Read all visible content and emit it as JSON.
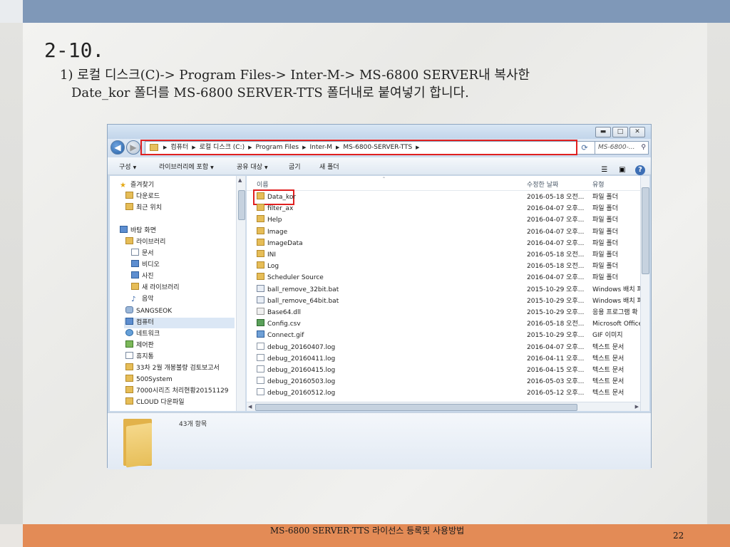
{
  "slide": {
    "title": "2-10.",
    "line1": "1) 로컬 디스크(C)-> Program Files-> Inter-M-> MS-6800 SERVER내 복사한",
    "line2": "Date_kor 폴더를 MS-6800 SERVER-TTS 폴더내로 붙여넣기 합니다.",
    "footer_text": "MS-6800 SERVER-TTS 라이선스 등록및 사용방법",
    "page_number": "22"
  },
  "explorer": {
    "address": [
      "컴퓨터",
      "로컬 디스크 (C:)",
      "Program Files",
      "Inter-M",
      "MS-6800-SERVER-TTS"
    ],
    "search_placeholder": "MS-6800-...",
    "toolbar": [
      "구성",
      "라이브러리에 포함",
      "공유 대상",
      "굽기",
      "새 폴더"
    ],
    "columns": {
      "name": "이름",
      "date": "수정한 날짜",
      "type": "유형"
    },
    "nav": [
      {
        "label": "즐겨찾기",
        "icon": "star-icon"
      },
      {
        "label": "다운로드",
        "icon": "folder-icon"
      },
      {
        "label": "최근 위치",
        "icon": "folder-icon"
      },
      {
        "label": "바탕 화면",
        "icon": "desktop-icon"
      },
      {
        "label": "라이브러리",
        "icon": "library-icon"
      },
      {
        "label": "문서",
        "icon": "document-icon"
      },
      {
        "label": "비디오",
        "icon": "video-icon"
      },
      {
        "label": "사진",
        "icon": "picture-icon"
      },
      {
        "label": "새 라이브러리",
        "icon": "library-icon"
      },
      {
        "label": "음악",
        "icon": "music-icon"
      },
      {
        "label": "SANGSEOK",
        "icon": "user-folder-icon"
      },
      {
        "label": "컴퓨터",
        "icon": "computer-icon"
      },
      {
        "label": "네트워크",
        "icon": "network-icon"
      },
      {
        "label": "제어판",
        "icon": "control-panel-icon"
      },
      {
        "label": "휴지통",
        "icon": "recycle-bin-icon"
      },
      {
        "label": "33차 2월 개봉불량 검토보고서",
        "icon": "folder-icon"
      },
      {
        "label": "500System",
        "icon": "folder-icon"
      },
      {
        "label": "7000시리즈 처리현황20151129",
        "icon": "folder-icon"
      },
      {
        "label": "CLOUD 다운파일",
        "icon": "folder-icon"
      }
    ],
    "files": [
      {
        "name": "Data_kor",
        "date": "2016-05-18 오전...",
        "type": "파일 폴더",
        "kind": "folder"
      },
      {
        "name": "filter_ax",
        "date": "2016-04-07 오후...",
        "type": "파일 폴더",
        "kind": "folder"
      },
      {
        "name": "Help",
        "date": "2016-04-07 오후...",
        "type": "파일 폴더",
        "kind": "folder"
      },
      {
        "name": "Image",
        "date": "2016-04-07 오후...",
        "type": "파일 폴더",
        "kind": "folder"
      },
      {
        "name": "ImageData",
        "date": "2016-04-07 오후...",
        "type": "파일 폴더",
        "kind": "folder"
      },
      {
        "name": "INI",
        "date": "2016-05-18 오전...",
        "type": "파일 폴더",
        "kind": "folder"
      },
      {
        "name": "Log",
        "date": "2016-05-18 오전...",
        "type": "파일 폴더",
        "kind": "folder"
      },
      {
        "name": "Scheduler Source",
        "date": "2016-04-07 오후...",
        "type": "파일 폴더",
        "kind": "folder"
      },
      {
        "name": "ball_remove_32bit.bat",
        "date": "2015-10-29 오후...",
        "type": "Windows 배치 파",
        "kind": "bat"
      },
      {
        "name": "ball_remove_64bit.bat",
        "date": "2015-10-29 오후...",
        "type": "Windows 배치 파",
        "kind": "bat"
      },
      {
        "name": "Base64.dll",
        "date": "2015-10-29 오후...",
        "type": "응용 프로그램 확",
        "kind": "dll"
      },
      {
        "name": "Config.csv",
        "date": "2016-05-18 오전...",
        "type": "Microsoft Office",
        "kind": "csv"
      },
      {
        "name": "Connect.gif",
        "date": "2015-10-29 오후...",
        "type": "GIF 이미지",
        "kind": "gif"
      },
      {
        "name": "debug_20160407.log",
        "date": "2016-04-07 오후...",
        "type": "텍스트 문서",
        "kind": "log"
      },
      {
        "name": "debug_20160411.log",
        "date": "2016-04-11 오후...",
        "type": "텍스트 문서",
        "kind": "log"
      },
      {
        "name": "debug_20160415.log",
        "date": "2016-04-15 오후...",
        "type": "텍스트 문서",
        "kind": "log"
      },
      {
        "name": "debug_20160503.log",
        "date": "2016-05-03 오후...",
        "type": "텍스트 문서",
        "kind": "log"
      },
      {
        "name": "debug_20160512.log",
        "date": "2016-05-12 오후...",
        "type": "텍스트 문서",
        "kind": "log"
      }
    ],
    "item_count": "43개 항목"
  }
}
